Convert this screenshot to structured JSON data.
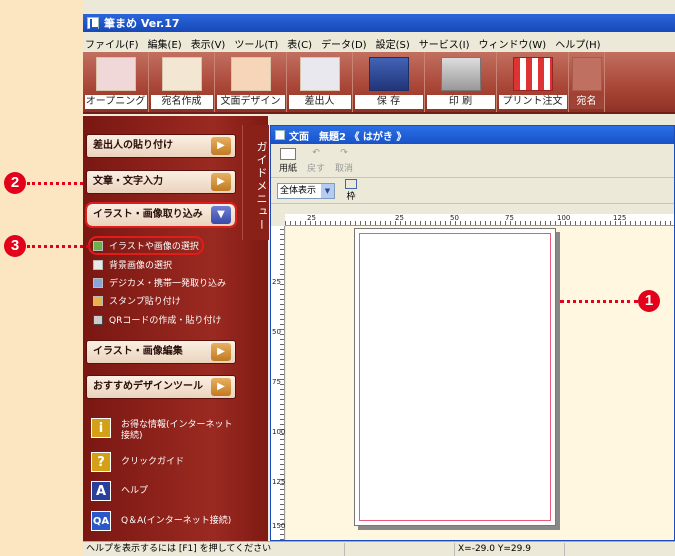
{
  "app": {
    "title": "筆まめ Ver.17"
  },
  "menu": [
    "ファイル(F)",
    "編集(E)",
    "表示(V)",
    "ツール(T)",
    "表(C)",
    "データ(D)",
    "設定(S)",
    "サービス(I)",
    "ウィンドウ(W)",
    "ヘルプ(H)"
  ],
  "toolbar": {
    "buttons": [
      {
        "label": "オープニング",
        "icon": "opening-icon"
      },
      {
        "label": "宛名作成",
        "icon": "address-icon"
      },
      {
        "label": "文面デザイン",
        "icon": "design-icon"
      },
      {
        "label": "差出人",
        "icon": "sender-icon"
      },
      {
        "label": "保 存",
        "icon": "floppy-icon"
      },
      {
        "label": "印 刷",
        "icon": "printer-icon"
      },
      {
        "label": "プリント注文",
        "icon": "shop-icon"
      },
      {
        "label": "宛名",
        "icon": "address-icon"
      }
    ]
  },
  "sidebar": {
    "guide_label": "ガイドメニュー",
    "sections": [
      {
        "label": "差出人の貼り付け"
      },
      {
        "label": "文章・文字入力"
      },
      {
        "label": "イラスト・画像取り込み"
      },
      {
        "label": "イラスト・画像編集"
      },
      {
        "label": "おすすめデザインツール"
      }
    ],
    "subitems": [
      {
        "label": "イラストや画像の選択"
      },
      {
        "label": "背景画像の選択"
      },
      {
        "label": "デジカメ・携帯一発取り込み"
      },
      {
        "label": "スタンプ貼り付け"
      },
      {
        "label": "QRコードの作成・貼り付け"
      }
    ],
    "info": [
      {
        "label": "お得な情報(インターネット接続)",
        "icon_text": "i"
      },
      {
        "label": "クリックガイド",
        "icon_text": "?"
      },
      {
        "label": "ヘルプ",
        "icon_text": "A"
      },
      {
        "label": "Q＆A(インターネット接続)",
        "icon_text": "QA"
      }
    ]
  },
  "document": {
    "title_prefix": "文面",
    "title": "無題2 《 はがき 》",
    "paper_button": "用紙",
    "undo_button": "戻す",
    "redo_button": "取消",
    "zoom_select": "全体表示",
    "frame_button": "枠",
    "hruler_labels": [
      "25",
      "",
      "25",
      "50",
      "75",
      "100",
      "125"
    ],
    "vruler_labels": [
      "",
      "25",
      "50",
      "75",
      "100",
      "125",
      "150"
    ]
  },
  "status": {
    "help_text": "ヘルプを表示するには [F1] を押してください",
    "coords": "X=-29.0 Y=29.9"
  },
  "callouts": [
    "1",
    "2",
    "3"
  ],
  "colors": {
    "callout": "#e2001a",
    "sidebar": "#8a2119",
    "page_bg": "#fbe6c1"
  }
}
